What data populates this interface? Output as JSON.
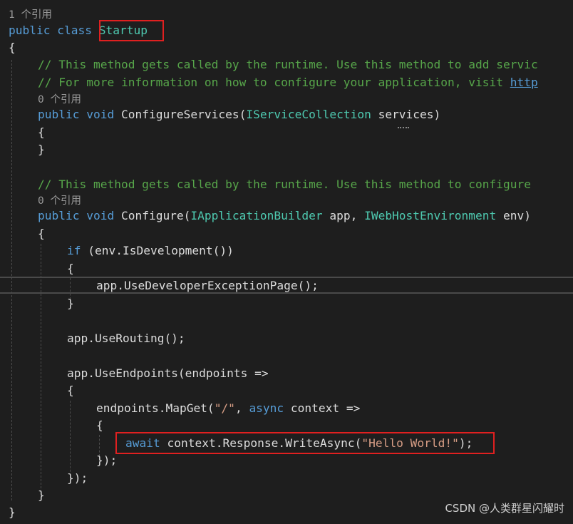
{
  "editor": {
    "codelens_class": "1 个引用",
    "codelens_configure_services": "0 个引用",
    "codelens_configure": "0 个引用",
    "kw_public": "public",
    "kw_class": "class",
    "class_name": "Startup",
    "brace_open": "{",
    "brace_close": "}",
    "comment_1": "// This method gets called by the runtime. Use this method to add servic",
    "comment_2_text": "// For more information on how to configure your application, visit ",
    "comment_2_link": "http",
    "kw_void": "void",
    "method_configure_services": " ConfigureServices(",
    "type_iservice_collection": "IServiceCollection",
    "param_services": " services)",
    "comment_3": "// This method gets called by the runtime. Use this method to configure",
    "method_configure": " Configure(",
    "type_iapp_builder": "IApplicationBuilder",
    "param_app": " app, ",
    "type_iweb_host_env": "IWebHostEnvironment",
    "param_env": " env)",
    "kw_if": "if",
    "if_condition": " (env.IsDevelopment())",
    "use_dev_exception_page": "app.UseDeveloperExceptionPage();",
    "use_routing": "app.UseRouting();",
    "use_endpoints": "app.UseEndpoints(endpoints =>",
    "map_get_prefix": "endpoints.MapGet(",
    "map_get_route": "\"/\"",
    "map_get_middle": ", ",
    "kw_async": "async",
    "map_get_suffix": " context =>",
    "kw_await": "await",
    "write_async_prefix": " context.Response.WriteAsync(",
    "hello_world": "\"Hello World!\"",
    "write_async_suffix": ");",
    "close_lambda_inner": "});",
    "close_lambda_outer": "});"
  },
  "watermark": "CSDN @人类群星闪耀时",
  "colors": {
    "background": "#1e1e1e",
    "keyword": "#569cd6",
    "type": "#4ec9b0",
    "comment": "#57a64a",
    "string": "#d69d85",
    "highlight_box": "#e02020"
  }
}
